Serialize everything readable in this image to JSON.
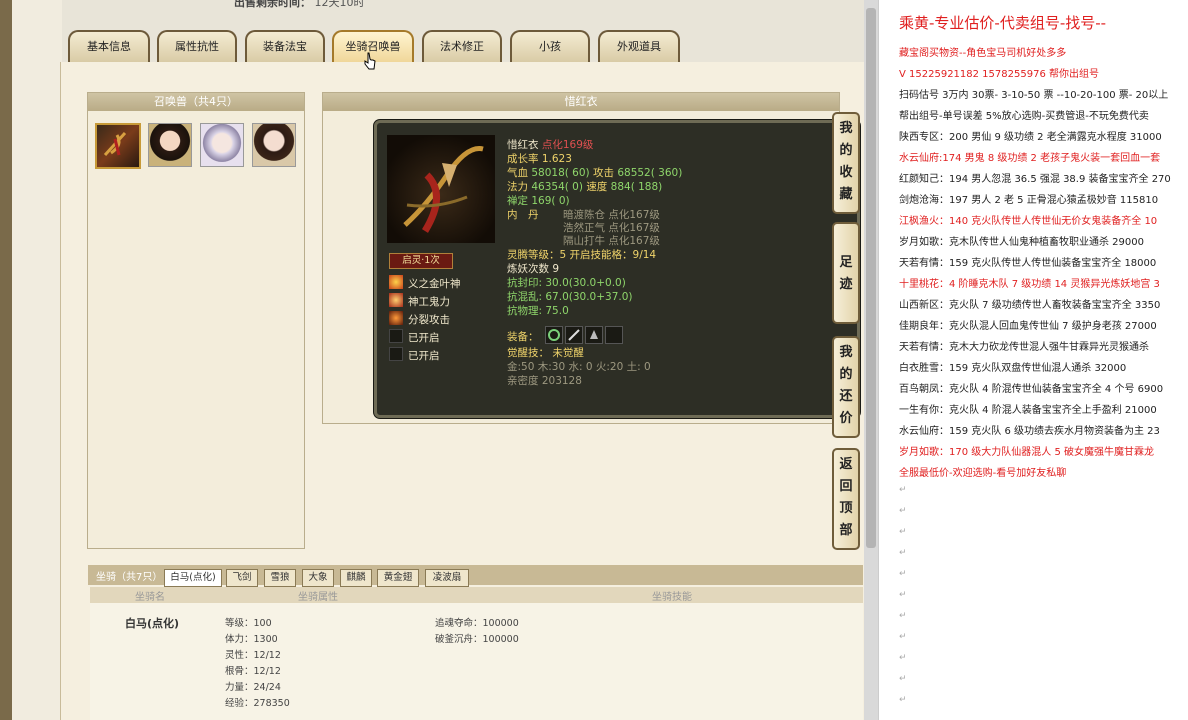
{
  "sale_time": {
    "label": "出售剩余时间：",
    "value": "12天10时"
  },
  "tabs": [
    "基本信息",
    "属性抗性",
    "装备法宝",
    "坐骑召唤兽",
    "法术修正",
    "小孩",
    "外观道具"
  ],
  "summon_panel": {
    "title": "召唤兽（共4只）"
  },
  "detail": {
    "title": "惜红衣",
    "name": "惜红衣",
    "refine": "点化169级",
    "growth": "成长率 1.623",
    "hp_label": "气血",
    "hp": "58018( 60)",
    "atk_label": "攻击",
    "atk": "68552( 360)",
    "mp_label": "法力",
    "mp": "46354( 0)",
    "spd_label": "速度",
    "spd": "884( 188)",
    "zen": "禅定 169( 0)",
    "neidan_label": "内　丹",
    "neidan": [
      "暗渡陈仓 点化167级",
      "浩然正气 点化167级",
      "隔山打牛 点化167级"
    ],
    "lingling": "灵腾等级：5 开启技能格：9/14",
    "lianyao": "炼妖次数 9",
    "kangfeng": "抗封印: 30.0(30.0+0.0)",
    "kanghun": "抗混乱: 67.0(30.0+37.0)",
    "kangwuli": "抗物理: 75.0",
    "equip_label": "装备：",
    "juexing": "觉醒技： 未觉醒",
    "elements": "金:50 木:30 水: 0 火:20 土: 0",
    "qinmi": "亲密度 203128",
    "qiling": "启灵·1次",
    "skills": [
      "义之金叶神",
      "神工鬼力",
      "分裂攻击",
      "已开启",
      "已开启"
    ]
  },
  "side_buttons": [
    "我的收藏",
    "足迹",
    "我的还价",
    "返回顶部"
  ],
  "mount": {
    "bar_label": "坐骑（共7只）",
    "tabs": [
      "白马(点化)",
      "飞剑",
      "雪狼",
      "大象",
      "麒麟",
      "黄金翅",
      "凌波扇"
    ],
    "col_name": "坐骑名",
    "col_attr": "坐骑属性",
    "col_skill": "坐骑技能",
    "name": "白马(点化)",
    "stats": [
      "等级：100",
      "体力：1300",
      "灵性：12/12",
      "根骨：12/12",
      "力量：24/24",
      "经验：278350"
    ],
    "skills": [
      "追魂夺命：100000",
      "破釜沉舟：100000"
    ]
  },
  "right": {
    "title": "乘黄-专业估价-代卖组号-找号--",
    "lines": [
      {
        "text": "藏宝阁买物资--角色宝马司机好处多多",
        "red": true
      },
      {
        "text": "V 15225921182  1578255976  帮你出组号",
        "red": true
      },
      {
        "text": "扫码估号 3万内 30票- 3-10-50 票  --10-20-100 票- 20以上",
        "red": false
      },
      {
        "text": "帮出组号-单号误差 5%放心选购-买费管退-不玩免费代卖",
        "red": false
      },
      {
        "text": "陕西专区：200 男仙 9 级功绩 2 老全满露克水程度 31000",
        "red": false
      },
      {
        "text": "水云仙府:174 男鬼 8 级功绩 2 老孩子鬼火装一套回血一套",
        "red": true
      },
      {
        "text": "红颜知己：194 男人忽混 36.5 强混 38.9 装备宝宝齐全 270",
        "red": false
      },
      {
        "text": "剑炮沧海：197 男人 2 老 5 正骨混心猿孟极妙音 115810",
        "red": false
      },
      {
        "text": "江枫渔火：140 克火队传世人传世仙无价女鬼装备齐全 10",
        "red": true
      },
      {
        "text": "岁月如歌：克木队传世人仙鬼种植畜牧职业通杀 29000",
        "red": false
      },
      {
        "text": "天若有情：159 克火队传世人传世仙装备宝宝齐全 18000",
        "red": false
      },
      {
        "text": "十里桃花：4 阶睡克木队 7 级功绩 14 灵猴异光炼妖地宫 3",
        "red": true
      },
      {
        "text": "山西新区：克火队 7 级功绩传世人畜牧装备宝宝齐全 3350",
        "red": false
      },
      {
        "text": "佳期良年：克火队混人回血鬼传世仙 7 级护身老孩 27000",
        "red": false
      },
      {
        "text": "天若有情：克木大力砍龙传世混人强牛甘霖异光灵猴通杀",
        "red": false
      },
      {
        "text": "白衣胜雪：159 克火队双盘传世仙混人通杀 32000",
        "red": false
      },
      {
        "text": "百鸟朝凤：克火队 4 阶混传世仙装备宝宝齐全 4 个号 6900",
        "red": false
      },
      {
        "text": "一生有你：克火队 4 阶混人装备宝宝齐全上手盈利 21000",
        "red": false
      },
      {
        "text": "水云仙府：159 克火队 6 级功绩去疾水月物资装备为主 23",
        "red": false
      },
      {
        "text": "岁月如歌：170 级大力队仙器混人 5 破女魔强牛魔甘霖龙",
        "red": true
      },
      {
        "text": "全服最低价-欢迎选购-看号加好友私聊",
        "red": true
      }
    ]
  }
}
